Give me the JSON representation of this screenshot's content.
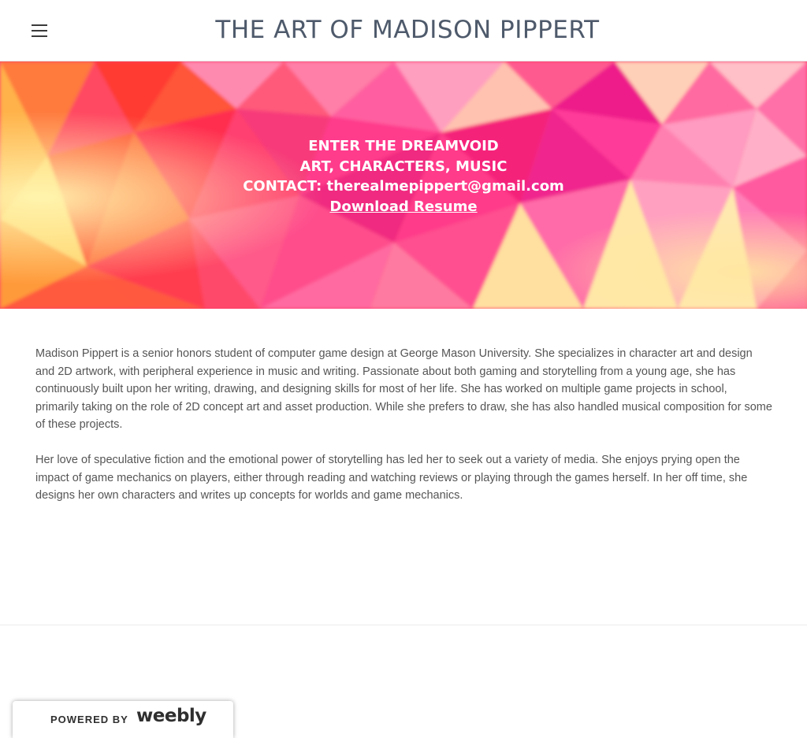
{
  "header": {
    "site_title": "THE ART OF MADISON PIPPERT",
    "menu_icon": "hamburger-menu-icon"
  },
  "banner": {
    "line1": "ENTER THE DREAMVOID",
    "line2": "ART, CHARACTERS, MUSIC",
    "contact_label": "CONTACT: ",
    "contact_email": "therealmepippert@gmail.com",
    "resume_link": "Download Resume",
    "colors": {
      "base": "#ff3d6b",
      "accent_yellow": "#ffe08a",
      "accent_magenta": "#f2208a"
    }
  },
  "content": {
    "paragraph1": "Madison Pippert is a senior honors student of computer game design at George Mason University. She specializes in character art and design and 2D artwork, with peripheral experience in music and writing. Passionate about both gaming and storytelling from a young age, she has continuously built upon her writing, drawing, and designing skills for most of her life. She has worked on multiple game projects in school, primarily taking on the role of 2D concept art and asset production. While she prefers to draw, she has also handled musical composition for some of these projects.",
    "paragraph2": "Her love of speculative fiction and the emotional power of storytelling has led her to seek out a variety of media. She enjoys prying open the impact of game mechanics on players, either through reading and watching reviews or playing through the games herself. In her off time, she designs her own characters and writes up concepts for worlds and game mechanics."
  },
  "footer": {
    "powered_by": "POWERED BY",
    "brand": "weebly"
  }
}
